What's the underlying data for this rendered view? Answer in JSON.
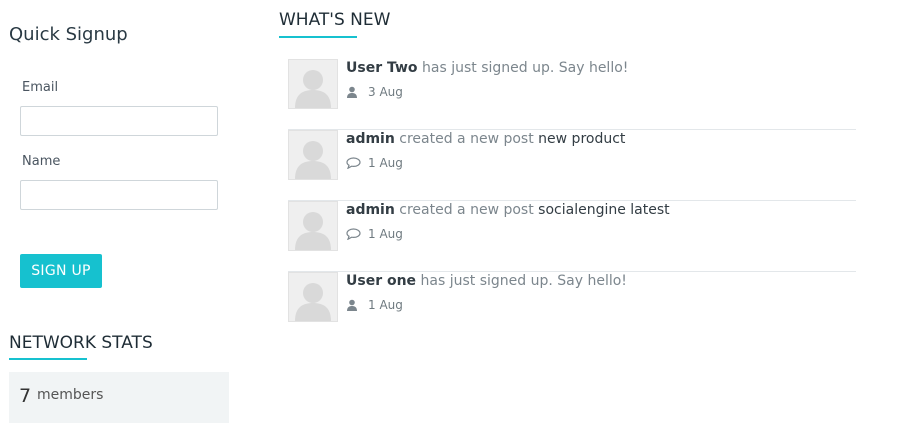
{
  "signup": {
    "title": "Quick Signup",
    "email_label": "Email",
    "email_value": "",
    "name_label": "Name",
    "name_value": "",
    "button_label": "SIGN UP"
  },
  "stats": {
    "title": "NETWORK STATS",
    "count": "7",
    "label": "members"
  },
  "feed": {
    "title": "WHAT'S NEW",
    "items": [
      {
        "user": "User Two",
        "action": " has just signed up. Say hello!",
        "object": "",
        "date": "3 Aug",
        "icon": "user-icon"
      },
      {
        "user": "admin",
        "action": " created a new post ",
        "object": "new product",
        "date": "1 Aug",
        "icon": "comment-icon"
      },
      {
        "user": "admin",
        "action": " created a new post ",
        "object": "socialengine latest",
        "date": "1 Aug",
        "icon": "comment-icon"
      },
      {
        "user": "User one",
        "action": " has just signed up. Say hello!",
        "object": "",
        "date": "1 Aug",
        "icon": "user-icon"
      }
    ]
  },
  "colors": {
    "accent": "#16c1cf",
    "text_dark": "#333d44",
    "text_muted": "#7c868d"
  }
}
